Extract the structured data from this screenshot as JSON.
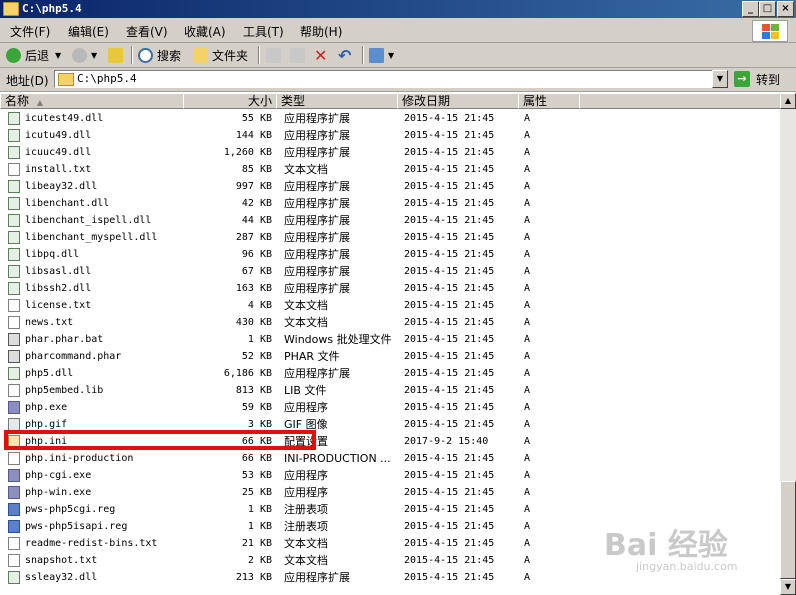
{
  "window": {
    "title": "C:\\php5.4"
  },
  "menu": [
    "文件(F)",
    "编辑(E)",
    "查看(V)",
    "收藏(A)",
    "工具(T)",
    "帮助(H)"
  ],
  "toolbar": {
    "back": "后退",
    "search": "搜索",
    "folders": "文件夹"
  },
  "address": {
    "label": "地址(D)",
    "value": "C:\\php5.4",
    "go": "转到"
  },
  "columns": {
    "name": "名称",
    "size": "大小",
    "type": "类型",
    "modified": "修改日期",
    "attr": "属性"
  },
  "files": [
    {
      "name": "icutest49.dll",
      "size": "55 KB",
      "type": "应用程序扩展",
      "date": "2015-4-15 21:45",
      "attr": "A",
      "icon": "dll"
    },
    {
      "name": "icutu49.dll",
      "size": "144 KB",
      "type": "应用程序扩展",
      "date": "2015-4-15 21:45",
      "attr": "A",
      "icon": "dll"
    },
    {
      "name": "icuuc49.dll",
      "size": "1,260 KB",
      "type": "应用程序扩展",
      "date": "2015-4-15 21:45",
      "attr": "A",
      "icon": "dll"
    },
    {
      "name": "install.txt",
      "size": "85 KB",
      "type": "文本文档",
      "date": "2015-4-15 21:45",
      "attr": "A",
      "icon": "txt"
    },
    {
      "name": "libeay32.dll",
      "size": "997 KB",
      "type": "应用程序扩展",
      "date": "2015-4-15 21:45",
      "attr": "A",
      "icon": "dll"
    },
    {
      "name": "libenchant.dll",
      "size": "42 KB",
      "type": "应用程序扩展",
      "date": "2015-4-15 21:45",
      "attr": "A",
      "icon": "dll"
    },
    {
      "name": "libenchant_ispell.dll",
      "size": "44 KB",
      "type": "应用程序扩展",
      "date": "2015-4-15 21:45",
      "attr": "A",
      "icon": "dll"
    },
    {
      "name": "libenchant_myspell.dll",
      "size": "287 KB",
      "type": "应用程序扩展",
      "date": "2015-4-15 21:45",
      "attr": "A",
      "icon": "dll"
    },
    {
      "name": "libpq.dll",
      "size": "96 KB",
      "type": "应用程序扩展",
      "date": "2015-4-15 21:45",
      "attr": "A",
      "icon": "dll"
    },
    {
      "name": "libsasl.dll",
      "size": "67 KB",
      "type": "应用程序扩展",
      "date": "2015-4-15 21:45",
      "attr": "A",
      "icon": "dll"
    },
    {
      "name": "libssh2.dll",
      "size": "163 KB",
      "type": "应用程序扩展",
      "date": "2015-4-15 21:45",
      "attr": "A",
      "icon": "dll"
    },
    {
      "name": "license.txt",
      "size": "4 KB",
      "type": "文本文档",
      "date": "2015-4-15 21:45",
      "attr": "A",
      "icon": "txt"
    },
    {
      "name": "news.txt",
      "size": "430 KB",
      "type": "文本文档",
      "date": "2015-4-15 21:45",
      "attr": "A",
      "icon": "txt"
    },
    {
      "name": "phar.phar.bat",
      "size": "1 KB",
      "type": "Windows 批处理文件",
      "date": "2015-4-15 21:45",
      "attr": "A",
      "icon": "bat"
    },
    {
      "name": "pharcommand.phar",
      "size": "52 KB",
      "type": "PHAR 文件",
      "date": "2015-4-15 21:45",
      "attr": "A",
      "icon": "bat"
    },
    {
      "name": "php5.dll",
      "size": "6,186 KB",
      "type": "应用程序扩展",
      "date": "2015-4-15 21:45",
      "attr": "A",
      "icon": "dll"
    },
    {
      "name": "php5embed.lib",
      "size": "813 KB",
      "type": "LIB 文件",
      "date": "2015-4-15 21:45",
      "attr": "A",
      "icon": "txt"
    },
    {
      "name": "php.exe",
      "size": "59 KB",
      "type": "应用程序",
      "date": "2015-4-15 21:45",
      "attr": "A",
      "icon": "php"
    },
    {
      "name": "php.gif",
      "size": "3 KB",
      "type": "GIF 图像",
      "date": "2015-4-15 21:45",
      "attr": "A",
      "icon": "gif"
    },
    {
      "name": "php.ini",
      "size": "66 KB",
      "type": "配置设置",
      "date": "2017-9-2 15:40",
      "attr": "A",
      "icon": "ini"
    },
    {
      "name": "php.ini-production",
      "size": "66 KB",
      "type": "INI-PRODUCTION ...",
      "date": "2015-4-15 21:45",
      "attr": "A",
      "icon": "txt"
    },
    {
      "name": "php-cgi.exe",
      "size": "53 KB",
      "type": "应用程序",
      "date": "2015-4-15 21:45",
      "attr": "A",
      "icon": "php"
    },
    {
      "name": "php-win.exe",
      "size": "25 KB",
      "type": "应用程序",
      "date": "2015-4-15 21:45",
      "attr": "A",
      "icon": "php"
    },
    {
      "name": "pws-php5cgi.reg",
      "size": "1 KB",
      "type": "注册表项",
      "date": "2015-4-15 21:45",
      "attr": "A",
      "icon": "reg"
    },
    {
      "name": "pws-php5isapi.reg",
      "size": "1 KB",
      "type": "注册表项",
      "date": "2015-4-15 21:45",
      "attr": "A",
      "icon": "reg"
    },
    {
      "name": "readme-redist-bins.txt",
      "size": "21 KB",
      "type": "文本文档",
      "date": "2015-4-15 21:45",
      "attr": "A",
      "icon": "txt"
    },
    {
      "name": "snapshot.txt",
      "size": "2 KB",
      "type": "文本文档",
      "date": "2015-4-15 21:45",
      "attr": "A",
      "icon": "txt"
    },
    {
      "name": "ssleay32.dll",
      "size": "213 KB",
      "type": "应用程序扩展",
      "date": "2015-4-15 21:45",
      "attr": "A",
      "icon": "dll"
    }
  ],
  "watermark": {
    "main": "Bai 经验",
    "sub": "jingyan.baidu.com"
  },
  "colors": {
    "highlight": "#e01010",
    "title_bar": "#0a246a",
    "chrome": "#d4d0c8"
  }
}
